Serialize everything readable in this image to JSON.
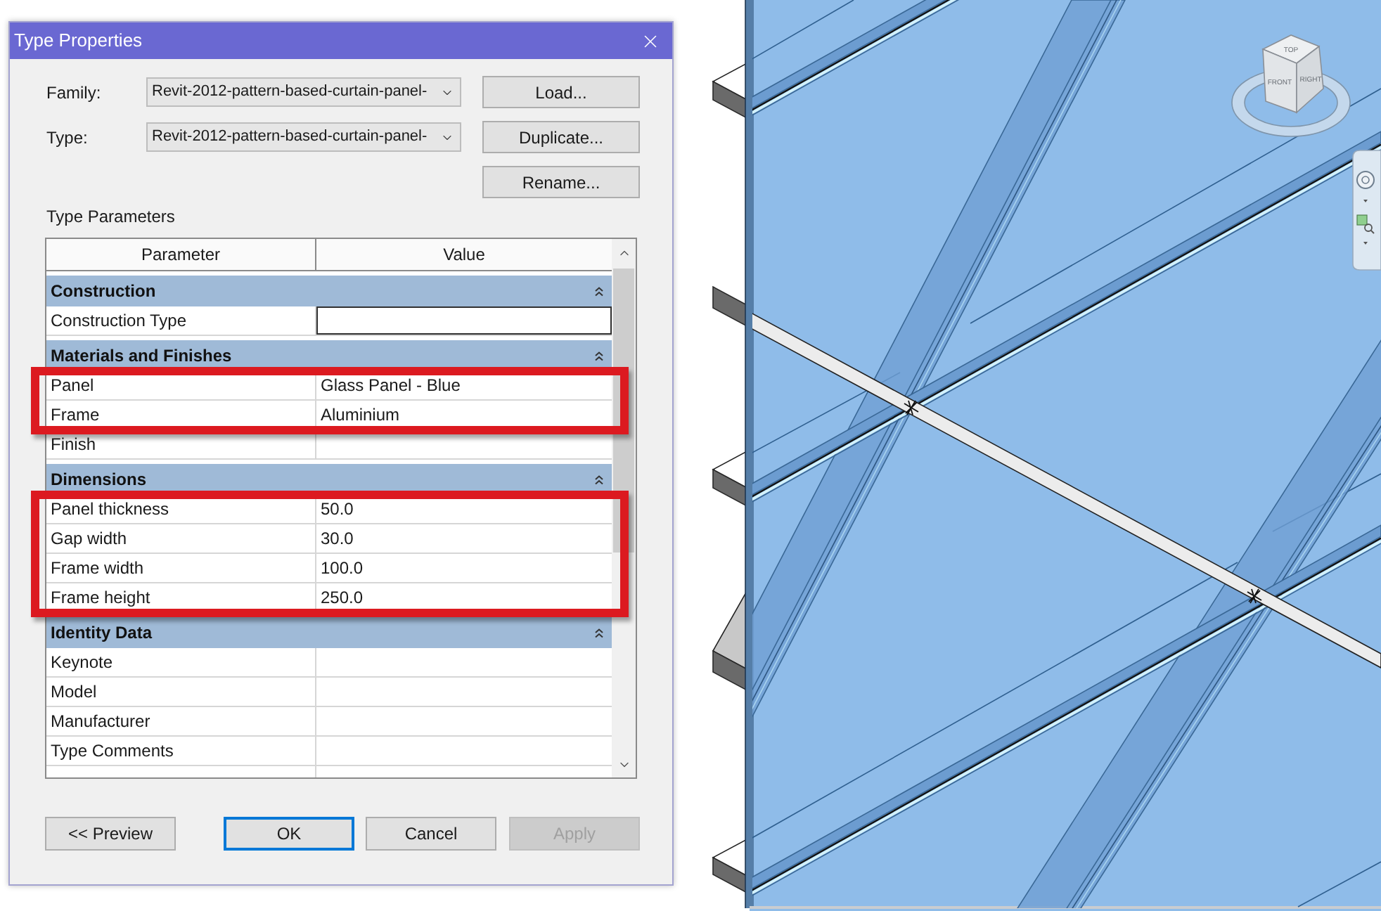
{
  "dialog": {
    "title": "Type Properties",
    "fields": [
      {
        "label": "Family:",
        "value": "Revit-2012-pattern-based-curtain-panel-"
      },
      {
        "label": "Type:",
        "value": "Revit-2012-pattern-based-curtain-panel-"
      }
    ],
    "side_buttons": [
      "Load...",
      "Duplicate...",
      "Rename..."
    ],
    "section_title": "Type Parameters",
    "table": {
      "columns": [
        "Parameter",
        "Value"
      ],
      "groups": [
        {
          "name": "Construction",
          "expanded": true,
          "rows": [
            {
              "parameter": "Construction Type",
              "selected": true,
              "highlighted": false
            }
          ]
        },
        {
          "name": "Materials and Finishes",
          "expanded": true,
          "rows": [
            {
              "parameter": "Panel",
              "value": "Glass Panel - Blue",
              "selected": false,
              "highlighted": true
            },
            {
              "parameter": "Frame",
              "value": "Aluminium",
              "selected": false,
              "highlighted": true
            },
            {
              "parameter": "Finish",
              "selected": false,
              "highlighted": false
            }
          ]
        },
        {
          "name": "Dimensions",
          "expanded": true,
          "rows": [
            {
              "parameter": "Panel thickness",
              "value": "50.0",
              "selected": false,
              "highlighted": true
            },
            {
              "parameter": "Gap width",
              "value": "30.0",
              "selected": false,
              "highlighted": true
            },
            {
              "parameter": "Frame width",
              "value": "100.0",
              "selected": false,
              "highlighted": true
            },
            {
              "parameter": "Frame height",
              "value": "250.0",
              "selected": false,
              "highlighted": true
            }
          ]
        },
        {
          "name": "Identity Data",
          "expanded": true,
          "rows": [
            {
              "parameter": "Keynote",
              "selected": false,
              "highlighted": false
            },
            {
              "parameter": "Model",
              "selected": false,
              "highlighted": false
            },
            {
              "parameter": "Manufacturer",
              "selected": false,
              "highlighted": false
            },
            {
              "parameter": "Type Comments",
              "selected": false,
              "highlighted": false
            }
          ]
        }
      ]
    },
    "buttons": [
      {
        "label": "<< Preview",
        "default": false,
        "disabled": false
      },
      {
        "label": "OK",
        "default": true,
        "disabled": false
      },
      {
        "label": "Cancel",
        "default": false,
        "disabled": false
      },
      {
        "label": "Apply",
        "default": false,
        "disabled": true
      }
    ]
  },
  "viewport": {
    "view_cube": {
      "top": "TOP",
      "front": "FRONT",
      "right": "RIGHT"
    }
  }
}
